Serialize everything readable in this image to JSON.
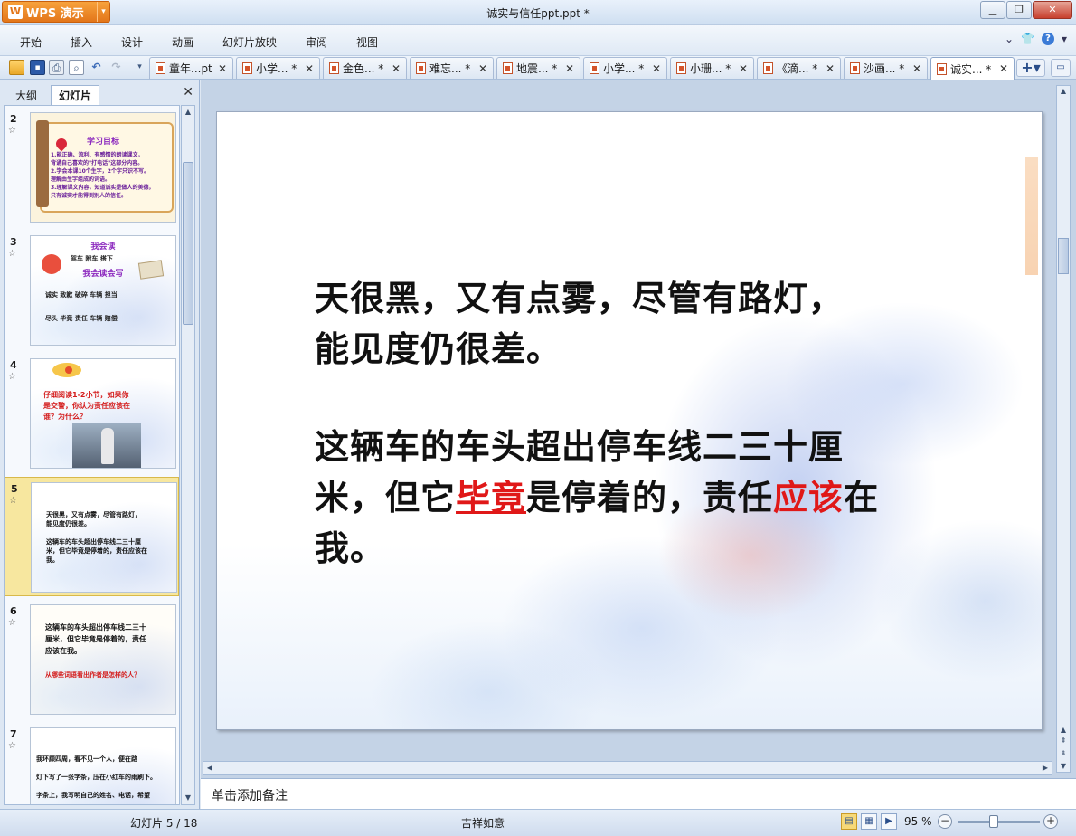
{
  "titlebar": {
    "app_button": "WPS 演示",
    "document_title": "诚实与信任ppt.ppt *",
    "minimize": "▭",
    "restore": "□",
    "close": "✕"
  },
  "menu": [
    "开始",
    "插入",
    "设计",
    "动画",
    "幻灯片放映",
    "审阅",
    "视图"
  ],
  "doc_tabs": [
    {
      "label": "童年...pt"
    },
    {
      "label": "小学... *"
    },
    {
      "label": "金色... *"
    },
    {
      "label": "难忘... *"
    },
    {
      "label": "地震... *"
    },
    {
      "label": "小学... *"
    },
    {
      "label": "小珊... *"
    },
    {
      "label": "《滴... *"
    },
    {
      "label": "沙画... *"
    },
    {
      "label": "诚实... *",
      "active": true
    }
  ],
  "side_panel": {
    "tabs": [
      "大纲",
      "幻灯片"
    ],
    "active_tab": "幻灯片",
    "close": "×",
    "thumbnails": [
      {
        "number": "2",
        "title": "学习目标",
        "lines": [
          "1.能正确、流利、有感情的朗读课文，",
          "背诵自己喜欢的\"打电话\"这部分内容。",
          "2.学会本课10个生字，2个字只识不写。",
          "理解由生字组成的词语。",
          "3.理解课文内容，知道诚实是做人的美德，",
          "只有诚实才能得到别人的信任。"
        ]
      },
      {
        "number": "3",
        "title": "我会读",
        "subtitle": "我会读会写",
        "row1": "驾车  附车  搭下",
        "row2": "诚实  致歉  破碎  车辆  担当",
        "row3": "尽头  毕竟  责任  车辆  赔偿"
      },
      {
        "number": "4",
        "lines": [
          "仔细阅读1-2小节，如果你",
          "是交警，你认为责任应该在",
          "谁？为什么？"
        ]
      },
      {
        "number": "5",
        "lines": [
          "天很黑，又有点雾，尽管有路灯，",
          "能见度仍很差。",
          "",
          "这辆车的车头超出停车线二三十厘",
          "米，但它毕竟是停着的，责任应该在",
          "我。"
        ]
      },
      {
        "number": "6",
        "lines": [
          "这辆车的车头超出停车线二三十",
          "厘米，但它毕竟是停着的，责任",
          "应该在我。"
        ],
        "question": "从哪些词语看出作者是怎样的人？"
      },
      {
        "number": "7",
        "lines": [
          "我环顾四周，看不见一个人，便在路",
          "灯下写了一张字条，压在小红车的雨刷下。",
          "字条上，我写明自己的姓名、电话，希望"
        ]
      }
    ]
  },
  "slide": {
    "para1_line1": "天很黑，又有点雾，尽管有路灯，",
    "para1_line2": "能见度仍很差。",
    "para2_line1": "这辆车的车头超出停车线二三十厘",
    "para2_line2_a": "米，但它",
    "para2_line2_b": "毕竟",
    "para2_line2_c": "是停着的，责任",
    "para2_line2_d": "应该",
    "para2_line2_e": "在",
    "para2_line3": "我。"
  },
  "notes_placeholder": "单击添加备注",
  "status": {
    "slide_indicator": "幻灯片 5 / 18",
    "theme": "吉祥如意",
    "zoom": "95 %"
  },
  "colors": {
    "emphasis": "#e01818",
    "selected_thumb": "#f7e79f"
  }
}
